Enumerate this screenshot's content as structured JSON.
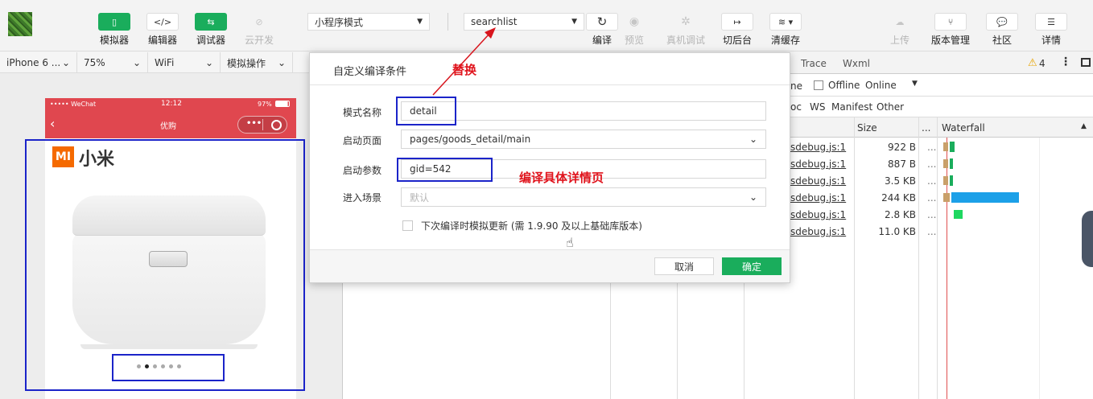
{
  "toolbar": {
    "left_buttons": [
      {
        "icon": "phone-icon",
        "label": "模拟器"
      },
      {
        "icon": "code-icon",
        "label": "编辑器"
      },
      {
        "icon": "swap-icon",
        "label": "调试器"
      },
      {
        "icon": "cloud-link-icon",
        "label": "云开发"
      }
    ],
    "mode_select": "小程序模式",
    "compile_select": "searchlist",
    "center_buttons": [
      {
        "icon": "refresh-icon",
        "label": "编译"
      },
      {
        "icon": "eye-icon",
        "label": "预览"
      },
      {
        "icon": "bug-icon",
        "label": "真机调试"
      },
      {
        "icon": "switch-background-icon",
        "label": "切后台"
      },
      {
        "icon": "layers-icon",
        "label": "清缓存"
      }
    ],
    "right_buttons": [
      {
        "icon": "upload-cloud-icon",
        "label": "上传"
      },
      {
        "icon": "branch-icon",
        "label": "版本管理"
      },
      {
        "icon": "chat-icon",
        "label": "社区"
      },
      {
        "icon": "menu-icon",
        "label": "详情"
      }
    ]
  },
  "device_bar": {
    "device": "iPhone 6 ...",
    "zoom": "75%",
    "network": "WiFi",
    "operation": "模拟操作"
  },
  "phone": {
    "carrier": "•••••  WeChat",
    "time": "12:12",
    "battery": "97%",
    "nav_title": "优购",
    "brand_logo": "MI",
    "brand_text": "小米",
    "swiper_total": 6,
    "swiper_active": 2
  },
  "devtools": {
    "tabs": [
      "Trace",
      "Wxml"
    ],
    "warning_count": "4",
    "filter": {
      "partial": "ne",
      "offline": "Offline",
      "online": "Online"
    },
    "types": [
      "oc",
      "WS",
      "Manifest",
      "Other"
    ],
    "headers": {
      "size": "Size",
      "more": "...",
      "waterfall": "Waterfall"
    },
    "rows": [
      {
        "name": "sdebug.js:1",
        "size": "922 B",
        "more": "..."
      },
      {
        "name": "sdebug.js:1",
        "size": "887 B",
        "more": "..."
      },
      {
        "name": "sdebug.js:1",
        "size": "3.5 KB",
        "more": "..."
      },
      {
        "name": "sdebug.js:1",
        "size": "244 KB",
        "more": "..."
      },
      {
        "name": "sdebug.js:1",
        "size": "2.8 KB",
        "more": "..."
      },
      {
        "name": "sdebug.js:1",
        "size": "11.0 KB",
        "more": "..."
      }
    ]
  },
  "dialog": {
    "title": "自定义编译条件",
    "fields": {
      "mode_name": {
        "label": "模式名称",
        "value": "detail"
      },
      "start_page": {
        "label": "启动页面",
        "value": "pages/goods_detail/main"
      },
      "start_params": {
        "label": "启动参数",
        "value": "gid=542"
      },
      "scene": {
        "label": "进入场景",
        "placeholder": "默认"
      }
    },
    "checkbox_label": "下次编译时模拟更新 (需 1.9.90 及以上基础库版本)",
    "cancel": "取消",
    "confirm": "确定"
  },
  "annotations": {
    "replace": "替换",
    "compile_detail": "编译具体详情页"
  }
}
